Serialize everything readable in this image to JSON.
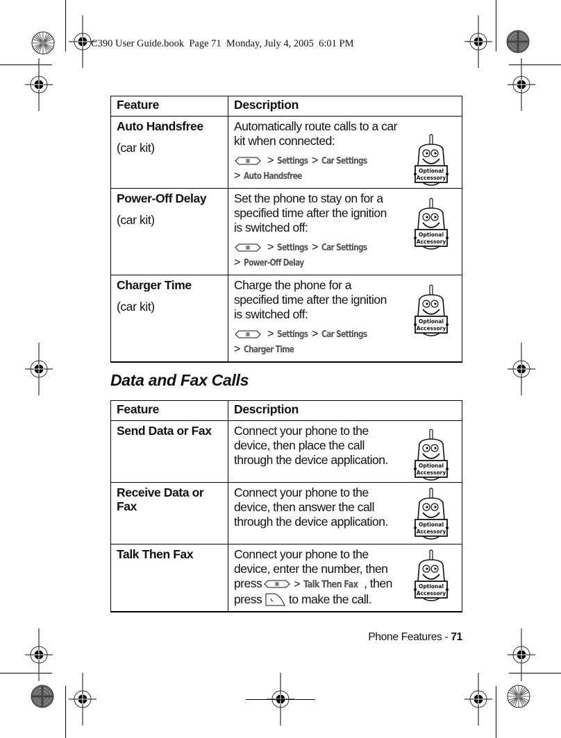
{
  "print_stamp": "C390 User Guide.book  Page 71  Monday, July 4, 2005  6:01 PM",
  "tables": [
    {
      "headers": {
        "feature": "Feature",
        "description": "Description"
      },
      "rows": [
        {
          "feature": "Auto Handsfree",
          "subtitle": "(car kit)",
          "description": "Automatically route calls to a car kit when connected:",
          "path": [
            "Settings",
            "Car Settings",
            "Auto Handsfree"
          ],
          "badge": "Optional Accessory"
        },
        {
          "feature": "Power-Off Delay",
          "subtitle": "(car kit)",
          "description": "Set the phone to stay on for a specified time after the ignition is switched off:",
          "path": [
            "Settings",
            "Car Settings",
            "Power-Off Delay"
          ],
          "badge": "Optional Accessory"
        },
        {
          "feature": "Charger Time",
          "subtitle": "(car kit)",
          "description": "Charge the phone for a specified time after the ignition is switched off:",
          "path": [
            "Settings",
            "Car Settings",
            "Charger Time"
          ],
          "badge": "Optional Accessory"
        }
      ]
    },
    {
      "section_title": "Data and Fax Calls",
      "headers": {
        "feature": "Feature",
        "description": "Description"
      },
      "rows": [
        {
          "feature": "Send Data or Fax",
          "description": "Connect your phone to the device, then place the call through the device application.",
          "badge": "Optional Accessory"
        },
        {
          "feature": "Receive Data or Fax",
          "description": "Connect your phone to the device, then answer the call through the device application.",
          "badge": "Optional Accessory"
        },
        {
          "feature": "Talk Then Fax",
          "description_parts": {
            "before": "Connect your phone to the device, enter the number, then press",
            "gt": ">",
            "menu_item": "Talk Then Fax",
            "middle": ", then press",
            "after": "to make the call."
          },
          "badge": "Optional Accessory"
        }
      ]
    }
  ],
  "path_separator": ">",
  "icons": {
    "menu_key": "menu-key-icon",
    "send_key": "send-key-icon",
    "accessory": "optional-accessory-icon",
    "registration": "registration-mark-icon",
    "color_wheel": "color-bar-icon"
  },
  "footer": {
    "section": "Phone Features - ",
    "page": "71"
  }
}
